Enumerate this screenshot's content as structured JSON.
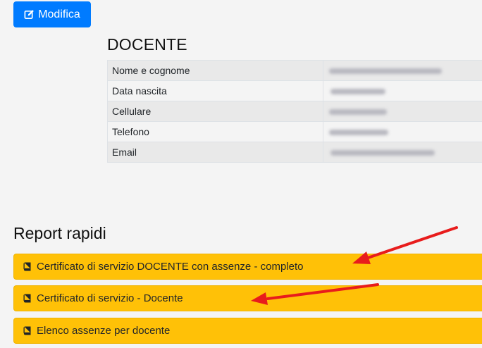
{
  "toolbar": {
    "edit_label": "Modifica"
  },
  "teacher": {
    "title": "DOCENTE",
    "fields": [
      {
        "label": "Nome e cognome"
      },
      {
        "label": "Data nascita"
      },
      {
        "label": "Cellulare"
      },
      {
        "label": "Telefono"
      },
      {
        "label": "Email"
      }
    ]
  },
  "reports": {
    "title": "Report rapidi",
    "items": [
      {
        "label": "Certificato di servizio DOCENTE con assenze - completo"
      },
      {
        "label": "Certificato di servizio - Docente"
      },
      {
        "label": "Elenco assenze per docente"
      }
    ]
  },
  "colors": {
    "primary_button": "#007bff",
    "report_button": "#ffc107",
    "annotation_arrow": "#e81c1c"
  },
  "icons": {
    "edit": "edit-icon",
    "report": "book-icon"
  }
}
